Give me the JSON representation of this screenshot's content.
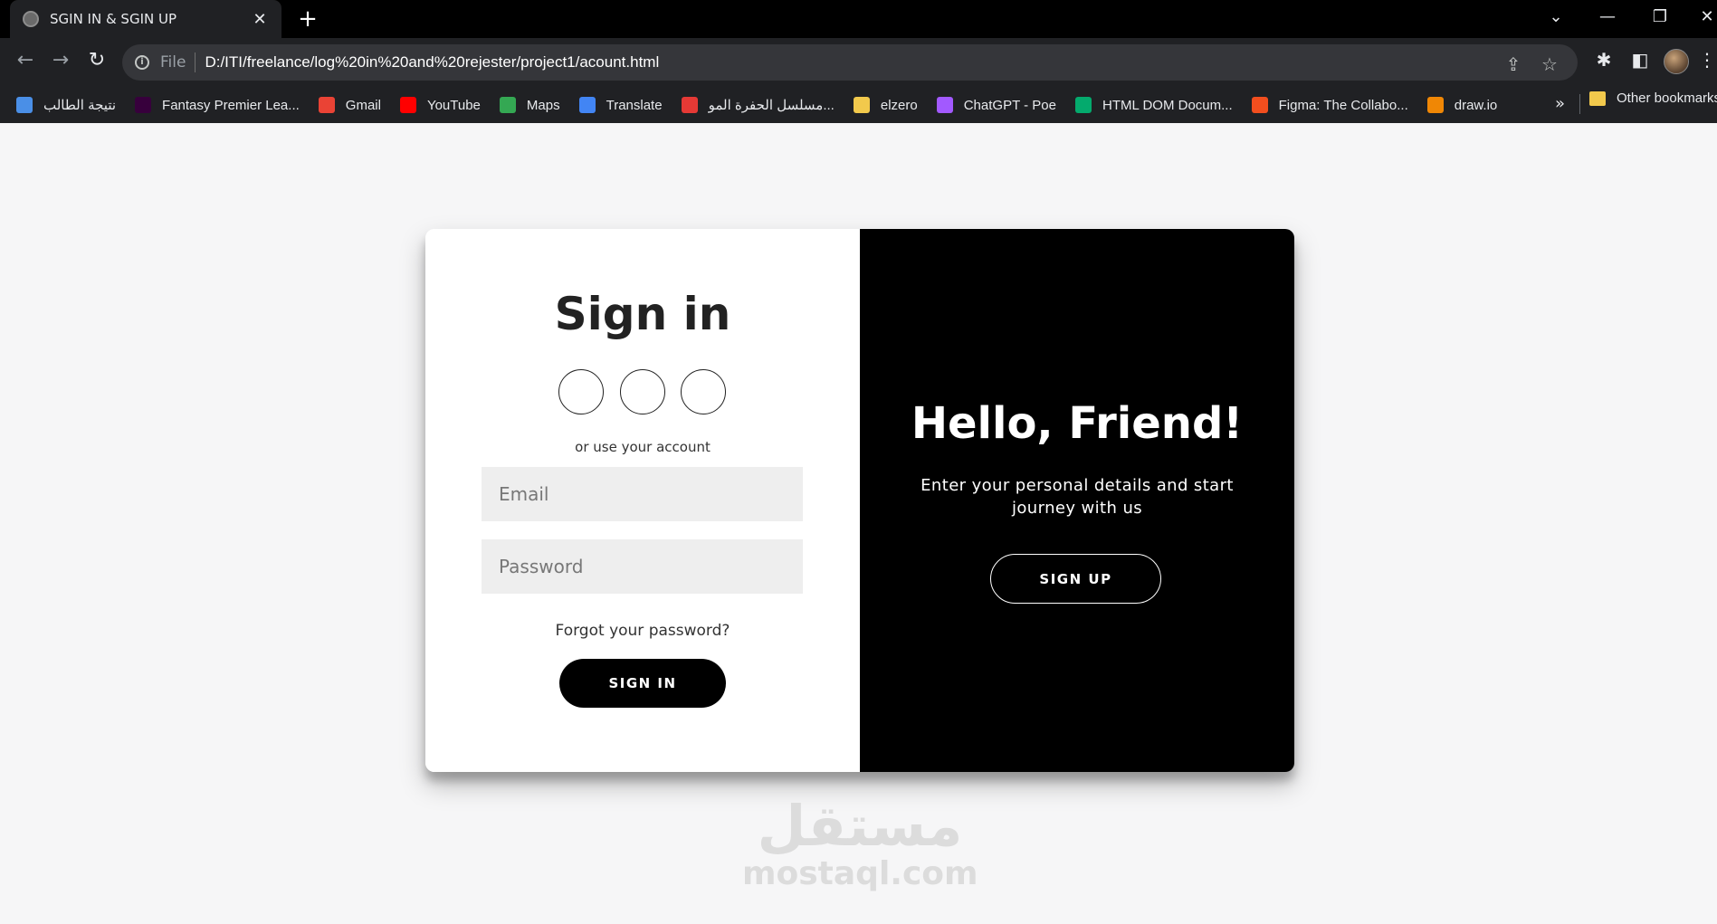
{
  "browser": {
    "tab_title": "SGIN IN & SGIN UP",
    "tab_close": "✕",
    "new_tab": "+",
    "scheme": "File",
    "url": "D:/ITI/freelance/log%20in%20and%20rejester/project1/acount.html",
    "icons": {
      "back": "back-arrow-icon",
      "forward": "forward-arrow-icon",
      "reload": "reload-icon",
      "share": "share-icon",
      "star": "bookmark-star-icon",
      "extensions": "puzzle-icon",
      "sidepanel": "side-panel-icon",
      "menu": "kebab-menu-icon"
    }
  },
  "bookmarks": [
    {
      "label": "نتيجة الطالب",
      "icon": "pin-icon",
      "color": "#4a8fe7"
    },
    {
      "label": "Fantasy Premier Lea...",
      "icon": "lion-icon",
      "color": "#37003c"
    },
    {
      "label": "Gmail",
      "icon": "gmail-icon",
      "color": "#ea4335"
    },
    {
      "label": "YouTube",
      "icon": "youtube-icon",
      "color": "#ff0000"
    },
    {
      "label": "Maps",
      "icon": "maps-icon",
      "color": "#34a853"
    },
    {
      "label": "Translate",
      "icon": "translate-icon",
      "color": "#4285f4"
    },
    {
      "label": "مسلسل الحفرة المو...",
      "icon": "tv-icon",
      "color": "#e53935"
    },
    {
      "label": "elzero",
      "icon": "folder-icon",
      "color": "#f2c94c"
    },
    {
      "label": "ChatGPT - Poe",
      "icon": "poe-icon",
      "color": "#a259ff"
    },
    {
      "label": "HTML DOM Docum...",
      "icon": "w3-icon",
      "color": "#04aa6d"
    },
    {
      "label": "Figma: The Collabo...",
      "icon": "figma-icon",
      "color": "#f24e1e"
    },
    {
      "label": "draw.io",
      "icon": "drawio-icon",
      "color": "#f08705"
    }
  ],
  "bookmarks_more": "»",
  "bookmarks_other": "Other bookmarks",
  "signin": {
    "title": "Sign in",
    "or_text": "or use your account",
    "email_placeholder": "Email",
    "password_placeholder": "Password",
    "forgot": "Forgot your password?",
    "button": "SIGN IN"
  },
  "overlay": {
    "title": "Hello, Friend!",
    "subtitle": "Enter your personal details and start journey with us",
    "button": "SIGN UP"
  },
  "watermark": {
    "arabic": "مستقل",
    "latin": "mostaql.com"
  }
}
